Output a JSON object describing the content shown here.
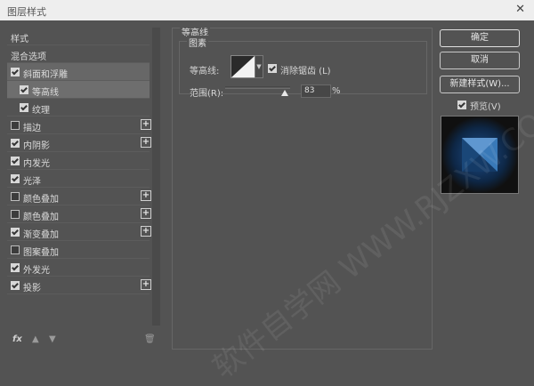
{
  "window": {
    "title": "图层样式",
    "close_glyph": "✕"
  },
  "left_list": {
    "items": [
      {
        "label": "样式",
        "checkbox": false,
        "checked": false,
        "plus": false,
        "selected": false,
        "sub": false
      },
      {
        "label": "混合选项",
        "checkbox": false,
        "checked": false,
        "plus": false,
        "selected": false,
        "sub": false
      },
      {
        "label": "斜面和浮雕",
        "checkbox": true,
        "checked": true,
        "plus": false,
        "selected": true,
        "sub": false
      },
      {
        "label": "等高线",
        "checkbox": true,
        "checked": true,
        "plus": false,
        "selected": "active",
        "sub": true
      },
      {
        "label": "纹理",
        "checkbox": true,
        "checked": true,
        "plus": false,
        "selected": false,
        "sub": true
      },
      {
        "label": "描边",
        "checkbox": true,
        "checked": false,
        "plus": true,
        "selected": false,
        "sub": false
      },
      {
        "label": "内阴影",
        "checkbox": true,
        "checked": true,
        "plus": true,
        "selected": false,
        "sub": false
      },
      {
        "label": "内发光",
        "checkbox": true,
        "checked": true,
        "plus": false,
        "selected": false,
        "sub": false
      },
      {
        "label": "光泽",
        "checkbox": true,
        "checked": true,
        "plus": false,
        "selected": false,
        "sub": false
      },
      {
        "label": "颜色叠加",
        "checkbox": true,
        "checked": false,
        "plus": true,
        "selected": false,
        "sub": false
      },
      {
        "label": "颜色叠加",
        "checkbox": true,
        "checked": false,
        "plus": true,
        "selected": false,
        "sub": false
      },
      {
        "label": "渐变叠加",
        "checkbox": true,
        "checked": true,
        "plus": true,
        "selected": false,
        "sub": false
      },
      {
        "label": "图案叠加",
        "checkbox": true,
        "checked": false,
        "plus": false,
        "selected": false,
        "sub": false
      },
      {
        "label": "外发光",
        "checkbox": true,
        "checked": true,
        "plus": false,
        "selected": false,
        "sub": false
      },
      {
        "label": "投影",
        "checkbox": true,
        "checked": true,
        "plus": true,
        "selected": false,
        "sub": false
      }
    ],
    "bottom_icons": [
      "fx-icon",
      "move-up-icon",
      "move-down-icon",
      "trash-icon"
    ],
    "fx_label": "fx"
  },
  "panel": {
    "group_title": "等高线",
    "subgroup_title": "图素",
    "contour_label": "等高线:",
    "antialias_label": "消除锯齿 (L)",
    "antialias_checked": true,
    "range_label": "范围(R):",
    "range_value": "83",
    "range_unit": "%"
  },
  "buttons": {
    "ok": "确定",
    "cancel": "取消",
    "new_style": "新建样式(W)..."
  },
  "preview": {
    "label": "预览(V)",
    "checked": true
  },
  "watermark": "软件自学网 WWW.RJZXW.COM"
}
